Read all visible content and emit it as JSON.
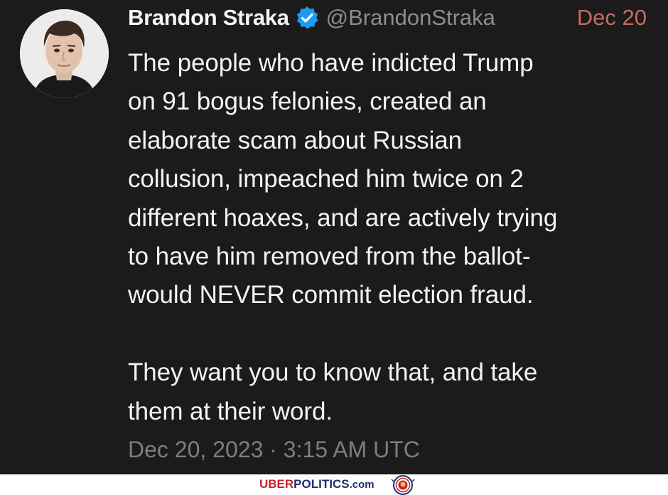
{
  "tweet": {
    "author_name": "Brandon Straka",
    "handle": "@BrandonStraka",
    "date_short": "Dec 20",
    "paragraphs": [
      "The people who have indicted Trump\non 91 bogus felonies, created an\nelaborate scam about Russian\ncollusion, impeached him twice on 2\ndifferent hoaxes, and are actively trying\nto have him removed from the ballot-\nwould NEVER commit election fraud.",
      "They want you to know that, and take\nthem at their word."
    ],
    "timestamp": "Dec 20, 2023 · 3:15 AM UTC",
    "verified_icon": "verified-badge-icon",
    "colors": {
      "background": "#1b1b1b",
      "date": "#c96a62",
      "handle": "#8d8d8d",
      "verified": "#1d9bf0"
    }
  },
  "footer": {
    "brand_red": "UBER",
    "brand_blue": "POLITICS",
    "brand_suffix": ".com",
    "seal_icon": "lion-seal-icon"
  }
}
